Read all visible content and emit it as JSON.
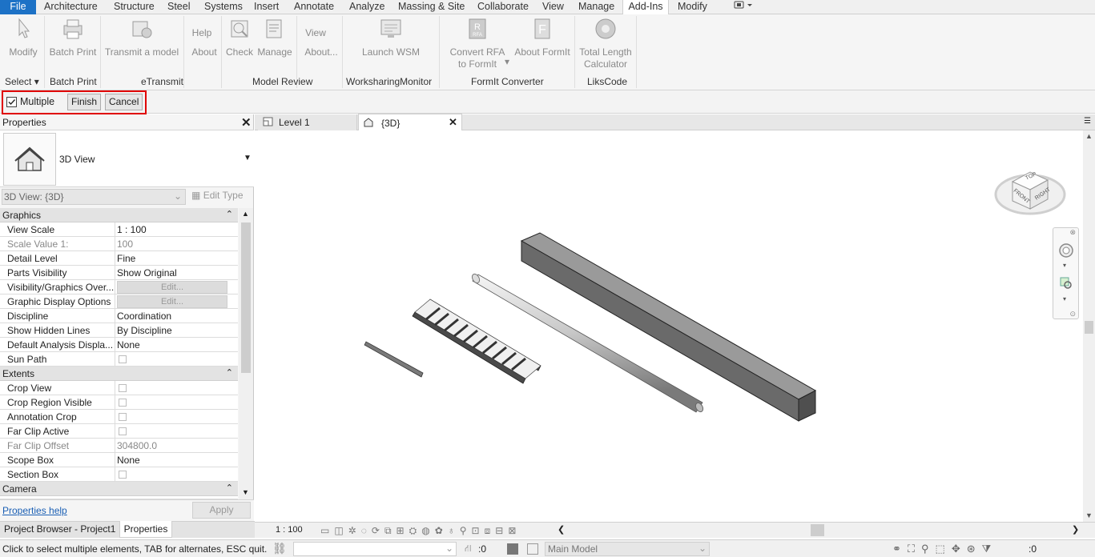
{
  "menu": {
    "file": "File",
    "items": [
      "Architecture",
      "Structure",
      "Steel",
      "Systems",
      "Insert",
      "Annotate",
      "Analyze",
      "Massing & Site",
      "Collaborate",
      "View",
      "Manage",
      "Add-Ins",
      "Modify"
    ],
    "active": "Add-Ins"
  },
  "ribbon": {
    "buttons": {
      "modify": "Modify",
      "batch_print": "Batch Print",
      "transmit": "Transmit a model",
      "help": "Help",
      "about": "About",
      "check": "Check",
      "manage": "Manage",
      "view": "View",
      "about2": "About...",
      "launch_wsm": "Launch WSM",
      "convert_rfa_1": "Convert RFA",
      "convert_rfa_2": "to FormIt",
      "about_formit": "About FormIt",
      "total_length_1": "Total Length",
      "total_length_2": "Calculator"
    },
    "groups": {
      "select": "Select",
      "batch_print": "Batch Print",
      "etransmit": "eTransmit",
      "model_review": "Model Review",
      "worksharing": "WorksharingMonitor",
      "formit": "FormIt Converter",
      "likscode": "LiksCode"
    }
  },
  "options_bar": {
    "multiple_label": "Multiple",
    "multiple_checked": true,
    "finish": "Finish",
    "cancel": "Cancel"
  },
  "properties": {
    "title": "Properties",
    "type_name": "3D View",
    "selector": "3D View: {3D}",
    "edit_type": "Edit Type",
    "graphics_header": "Graphics",
    "graphics": [
      {
        "k": "View Scale",
        "v": "1 : 100"
      },
      {
        "k": "Scale Value    1:",
        "v": "100"
      },
      {
        "k": "Detail Level",
        "v": "Fine"
      },
      {
        "k": "Parts Visibility",
        "v": "Show Original"
      },
      {
        "k": "Visibility/Graphics Over...",
        "v": "Edit..."
      },
      {
        "k": "Graphic Display Options",
        "v": "Edit..."
      },
      {
        "k": "Discipline",
        "v": "Coordination"
      },
      {
        "k": "Show Hidden Lines",
        "v": "By Discipline"
      },
      {
        "k": "Default Analysis Displa...",
        "v": "None"
      },
      {
        "k": "Sun Path",
        "v": ""
      }
    ],
    "extents_header": "Extents",
    "extents": [
      {
        "k": "Crop View",
        "v": ""
      },
      {
        "k": "Crop Region Visible",
        "v": ""
      },
      {
        "k": "Annotation Crop",
        "v": ""
      },
      {
        "k": "Far Clip Active",
        "v": ""
      },
      {
        "k": "Far Clip Offset",
        "v": "304800.0"
      },
      {
        "k": "Scope Box",
        "v": "None"
      },
      {
        "k": "Section Box",
        "v": ""
      }
    ],
    "camera_header": "Camera",
    "help_link": "Properties help",
    "apply": "Apply"
  },
  "bottom_tabs": {
    "project_browser": "Project Browser - Project1",
    "properties": "Properties"
  },
  "view_tabs": {
    "level1": "Level 1",
    "view3d": "{3D}"
  },
  "viewcube": {
    "top": "TOP",
    "front": "FRONT",
    "right": "RIGHT"
  },
  "view_status": {
    "scale": "1 : 100"
  },
  "status": {
    "message": "Click to select multiple elements, TAB for alternates, ESC quit.",
    "filter_count": ":0",
    "workset": "Main Model",
    "selection_count": ":0"
  }
}
